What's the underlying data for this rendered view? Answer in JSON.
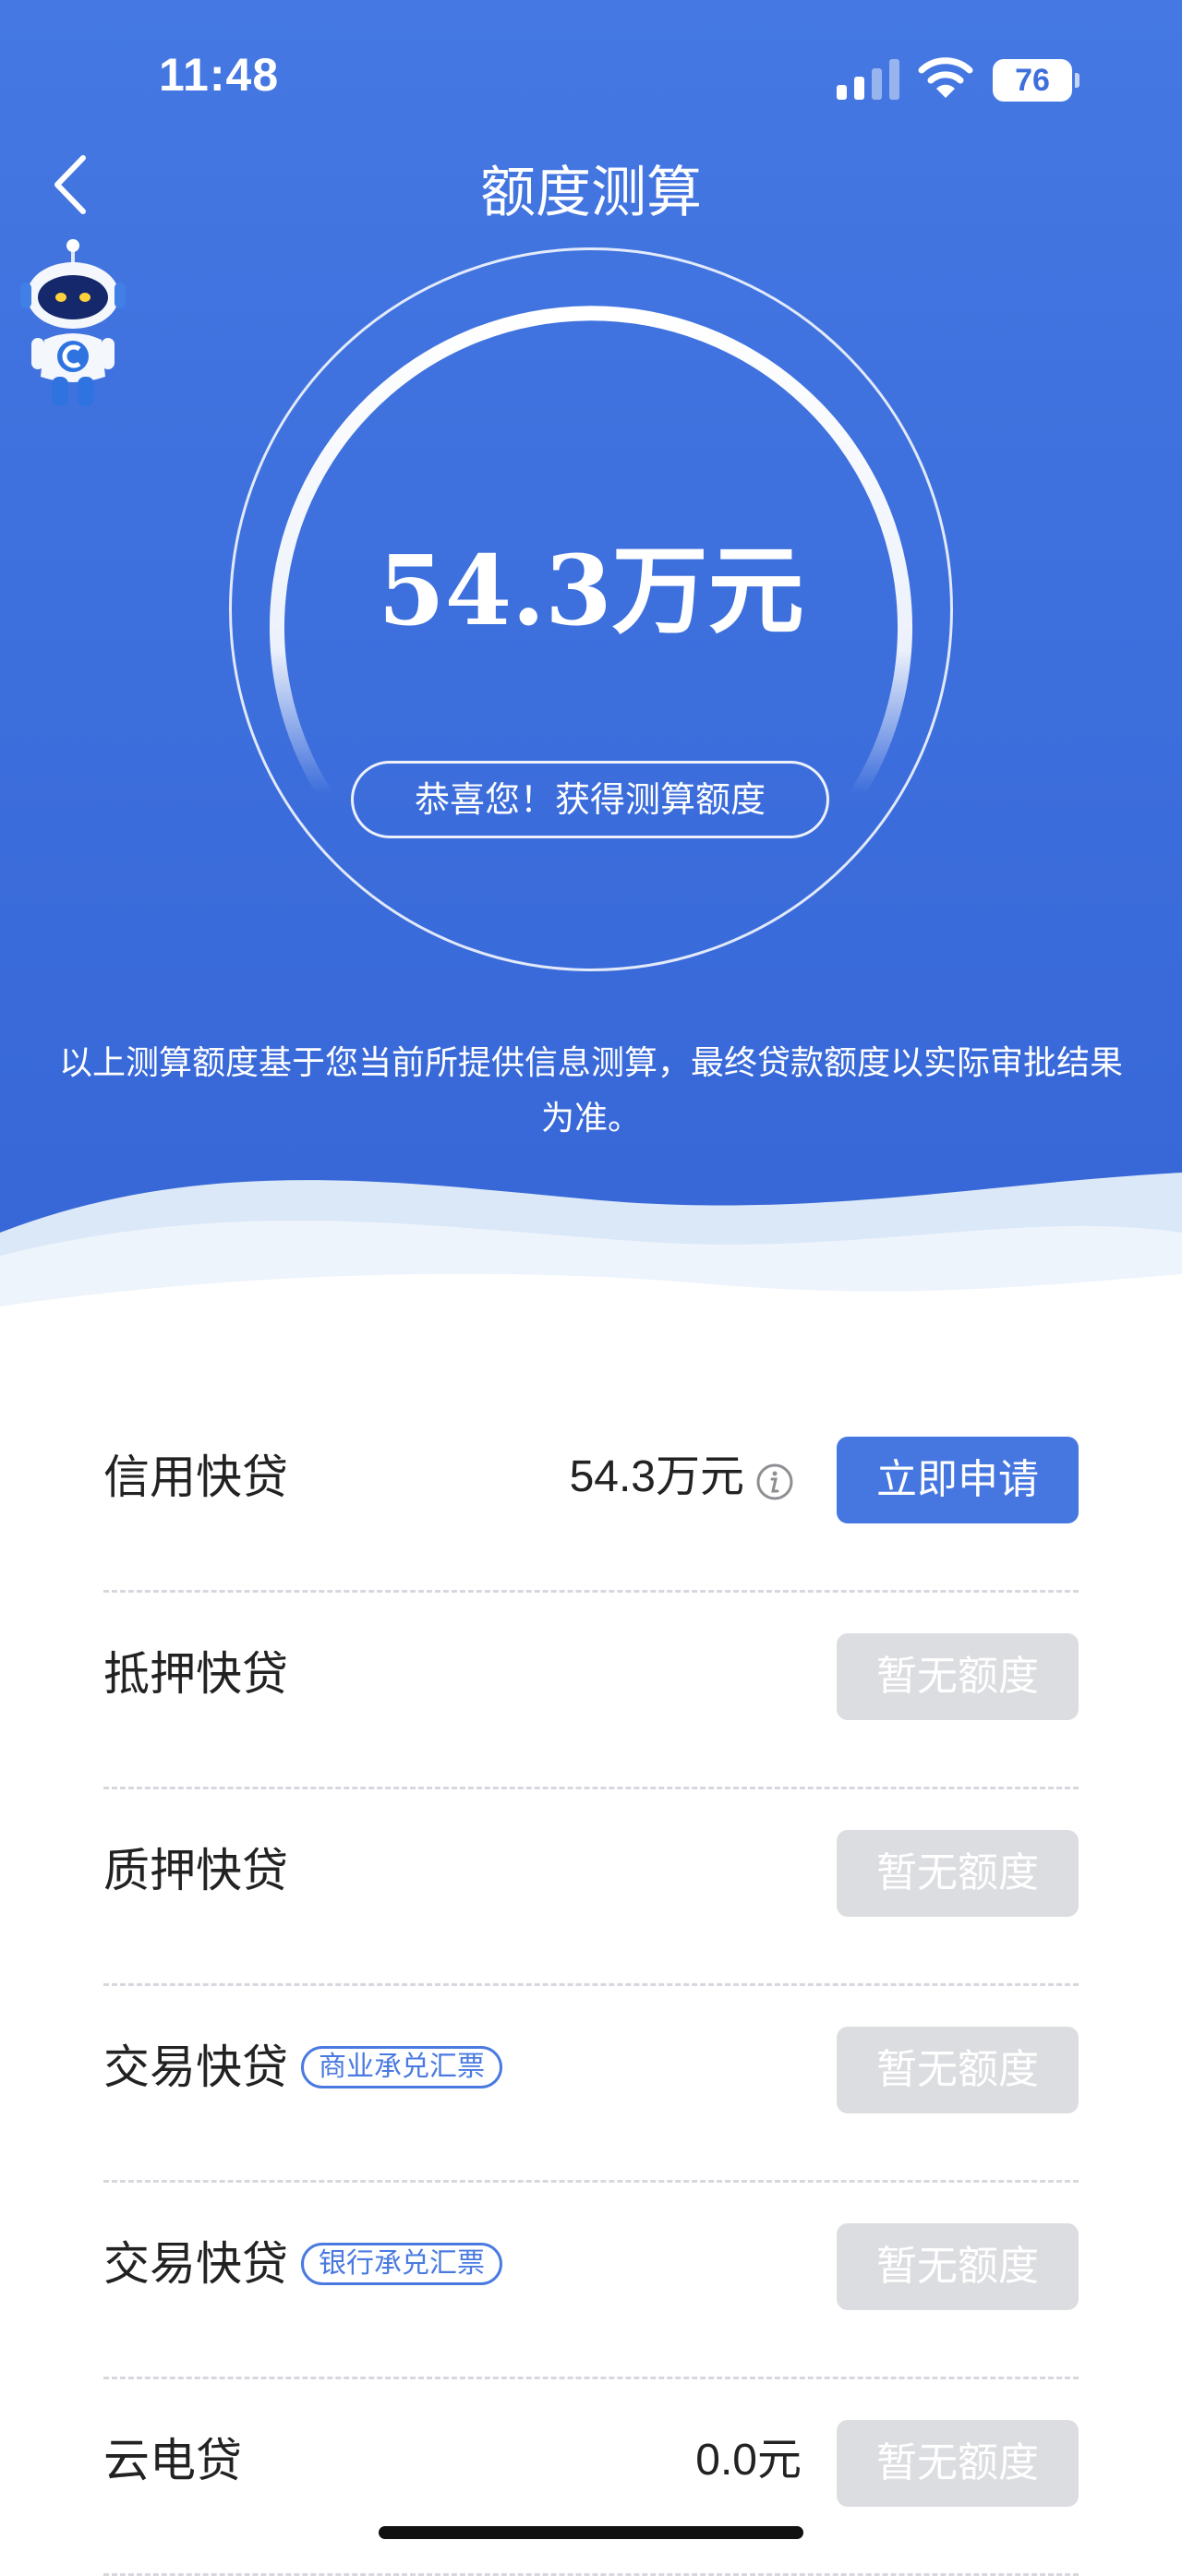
{
  "status_bar": {
    "time": "11:48",
    "battery": "76"
  },
  "header": {
    "title": "额度测算"
  },
  "result": {
    "amount": "54.3万元",
    "congrats": "恭喜您！获得测算额度",
    "notice": "以上测算额度基于您当前所提供信息测算，最终贷款额度以实际审批结果为准。"
  },
  "products": [
    {
      "name": "信用快贷",
      "tag": "",
      "amount": "54.3万元",
      "button": "立即申请"
    },
    {
      "name": "抵押快贷",
      "tag": "",
      "amount": "",
      "button": "暂无额度"
    },
    {
      "name": "质押快贷",
      "tag": "",
      "amount": "",
      "button": "暂无额度"
    },
    {
      "name": "交易快贷",
      "tag": "商业承兑汇票",
      "amount": "",
      "button": "暂无额度"
    },
    {
      "name": "交易快贷",
      "tag": "银行承兑汇票",
      "amount": "",
      "button": "暂无额度"
    },
    {
      "name": "云电贷",
      "tag": "",
      "amount": "0.0元",
      "button": "暂无额度"
    }
  ],
  "colors": {
    "primary": "#4677e0",
    "hero": "#3d6fdd",
    "disabled": "#dcdde0"
  }
}
